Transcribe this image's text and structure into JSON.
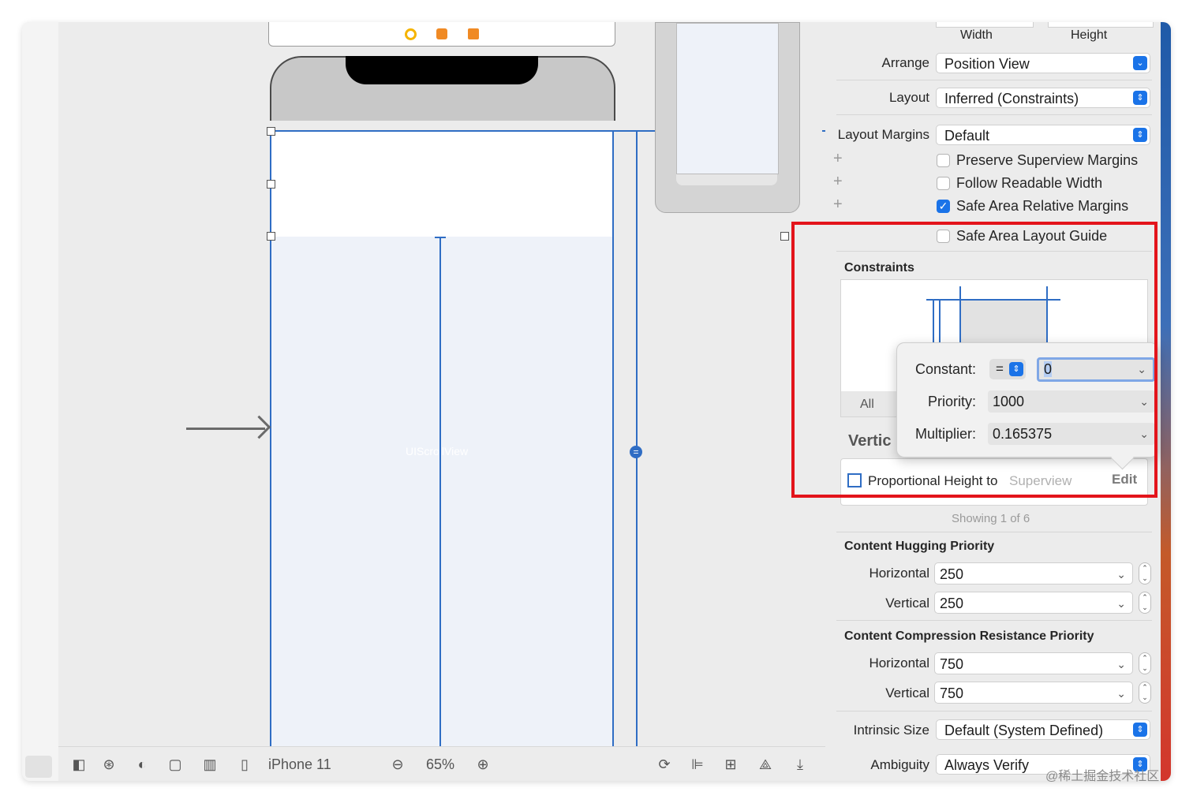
{
  "canvas": {
    "view_label": "UIScrollView",
    "device": "iPhone 11",
    "zoom": "65%"
  },
  "inspector": {
    "size_labels": {
      "width": "Width",
      "height": "Height"
    },
    "arrange": {
      "label": "Arrange",
      "value": "Position View"
    },
    "layout": {
      "label": "Layout",
      "value": "Inferred (Constraints)"
    },
    "layout_margins": {
      "label": "Layout Margins",
      "value": "Default"
    },
    "checkboxes": [
      {
        "label": "Preserve Superview Margins",
        "checked": false
      },
      {
        "label": "Follow Readable Width",
        "checked": false
      },
      {
        "label": "Safe Area Relative Margins",
        "checked": true
      },
      {
        "label": "Safe Area Layout Guide",
        "checked": false
      }
    ],
    "constraints": {
      "title": "Constraints",
      "tab_all": "All",
      "vertical_prefix": "Vertic",
      "item": {
        "name": "Proportional Height to",
        "target": "Superview",
        "action": "Edit"
      },
      "showing": "Showing 1 of 6"
    },
    "popover": {
      "constant_label": "Constant:",
      "relation": "=",
      "constant_value": "0",
      "priority_label": "Priority:",
      "priority_value": "1000",
      "multiplier_label": "Multiplier:",
      "multiplier_value": "0.165375"
    },
    "hugging": {
      "title": "Content Hugging Priority",
      "horizontal_label": "Horizontal",
      "horizontal_value": "250",
      "vertical_label": "Vertical",
      "vertical_value": "250"
    },
    "compression": {
      "title": "Content Compression Resistance Priority",
      "horizontal_label": "Horizontal",
      "horizontal_value": "750",
      "vertical_label": "Vertical",
      "vertical_value": "750"
    },
    "intrinsic": {
      "label": "Intrinsic Size",
      "value": "Default (System Defined)"
    },
    "ambiguity": {
      "label": "Ambiguity",
      "value": "Always Verify"
    }
  },
  "watermark": "@稀土掘金技术社区",
  "colors": {
    "accent": "#1a73e8",
    "highlight_box": "#e3141b",
    "constraint_line": "#2f6dc4"
  }
}
